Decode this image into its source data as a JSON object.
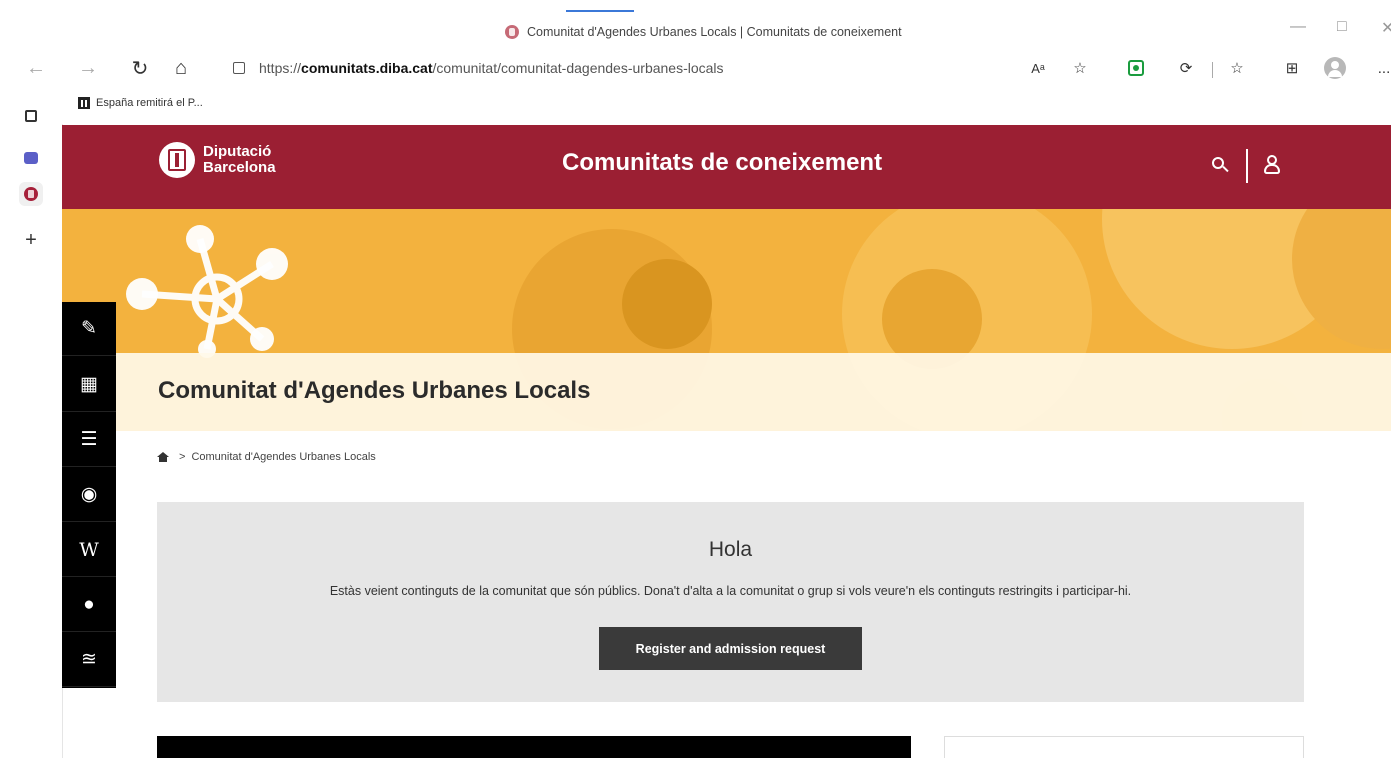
{
  "browser": {
    "tab_title": "Comunitat d'Agendes Urbanes Locals | Comunitats de coneixement",
    "url_scheme": "https://",
    "url_host": "comunitats.diba.cat",
    "url_path": "/comunitat/comunitat-dagendes-urbanes-locals",
    "favorites": [
      {
        "label": "España remitirá el P..."
      }
    ],
    "more_label": "...",
    "read_aloud_label": "Aᵃ"
  },
  "site": {
    "logo_line1": "Diputació",
    "logo_line2": "Barcelona",
    "title": "Comunitats de coneixement"
  },
  "page": {
    "title": "Comunitat d'Agendes Urbanes Locals",
    "breadcrumb_sep": ">",
    "breadcrumb_current": "Comunitat d'Agendes Urbanes Locals"
  },
  "info": {
    "title": "Hola",
    "text": "Estàs veient continguts de la comunitat que són públics. Dona't d'alta a la comunitat o grup si vols veure'n els continguts restringits i participar-hi.",
    "button_label": "Register and admission request"
  },
  "toolbar_icons": [
    "pencil-icon",
    "calendar-icon",
    "list-icon",
    "camera-icon",
    "wiki-icon",
    "chat-icon",
    "rss-icon"
  ],
  "colors": {
    "header_red": "#9b1f33",
    "banner_orange": "#f3b23e",
    "button_dark": "#3a3a3a"
  }
}
